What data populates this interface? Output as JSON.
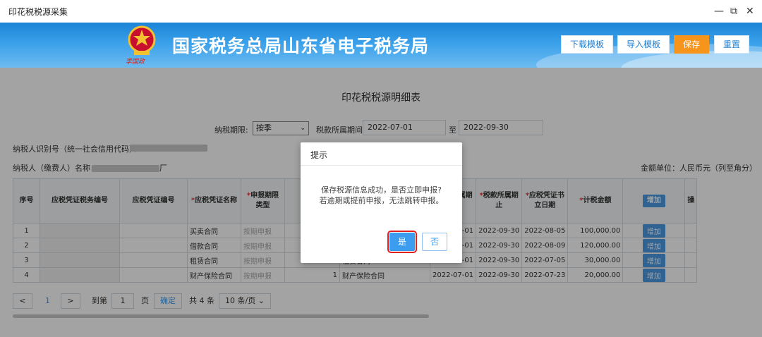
{
  "window": {
    "title": "印花税税源采集",
    "minimize": "—",
    "restore": "⧉",
    "close": "✕"
  },
  "header": {
    "org_title": "国家税务总局山东省电子税务局",
    "signature": "李国政",
    "buttons": {
      "download_template": "下载模板",
      "import_template": "导入模板",
      "save": "保存",
      "reset": "重置"
    }
  },
  "form": {
    "title": "印花税税源明细表",
    "period_label": "纳税期限:",
    "period_value": "按季",
    "tax_period_label": "税款所属期间:",
    "tax_period_start": "2022-07-01",
    "tax_period_to": "至",
    "tax_period_end": "2022-09-30",
    "taxpayer_id_label": "纳税人识别号（统一社会信用代码）：",
    "taxpayer_name_label": "纳税人（缴费人）名称：",
    "taxpayer_name_tail": "厂",
    "currency_unit": "金额单位：人民币元（列至角分）"
  },
  "table": {
    "headers": {
      "seq": "序号",
      "voucher_tax_no": "应税凭证税务编号",
      "voucher_no": "应税凭证编号",
      "voucher_name": "应税凭证名称",
      "report_type": "申报期限类型",
      "partial": "应税",
      "tax_start": "税款所属期起",
      "tax_end": "税款所属期止",
      "issue_date": "应税凭证书立日期",
      "tax_amount": "计税金额",
      "add": "增加",
      "edge": "操"
    },
    "rows": [
      {
        "seq": "1",
        "voucher_name": "买卖合同",
        "report_type": "按期申报",
        "qty": "",
        "item_name": "",
        "start": "2022-07-01",
        "end": "2022-09-30",
        "issue": "2022-08-05",
        "amount": "100,000.00",
        "add": "增加"
      },
      {
        "seq": "2",
        "voucher_name": "借款合同",
        "report_type": "按期申报",
        "qty": "",
        "item_name": "",
        "start": "2022-07-01",
        "end": "2022-09-30",
        "issue": "2022-08-09",
        "amount": "120,000.00",
        "add": "增加"
      },
      {
        "seq": "3",
        "voucher_name": "租赁合同",
        "report_type": "按期申报",
        "qty": "1",
        "item_name": "租赁合同",
        "start": "2022-07-01",
        "end": "2022-09-30",
        "issue": "2022-07-05",
        "amount": "30,000.00",
        "add": "增加"
      },
      {
        "seq": "4",
        "voucher_name": "财产保险合同",
        "report_type": "按期申报",
        "qty": "1",
        "item_name": "财产保险合同",
        "start": "2022-07-01",
        "end": "2022-09-30",
        "issue": "2022-07-23",
        "amount": "20,000.00",
        "add": "增加"
      }
    ]
  },
  "pager": {
    "prev": "<",
    "current": "1",
    "next": ">",
    "goto_label": "到第",
    "goto_value": "1",
    "page_unit": "页",
    "confirm": "确定",
    "total": "共 4 条",
    "page_size": "10 条/页"
  },
  "dialog": {
    "title": "提示",
    "line1": "保存税源信息成功，是否立即申报?",
    "line2": "若逾期或提前申报，无法跳转申报。",
    "yes": "是",
    "no": "否"
  },
  "colors": {
    "banner": "#2c93e3",
    "accent": "#3c9cf0",
    "save": "#f6941b",
    "highlight": "#e32020"
  }
}
